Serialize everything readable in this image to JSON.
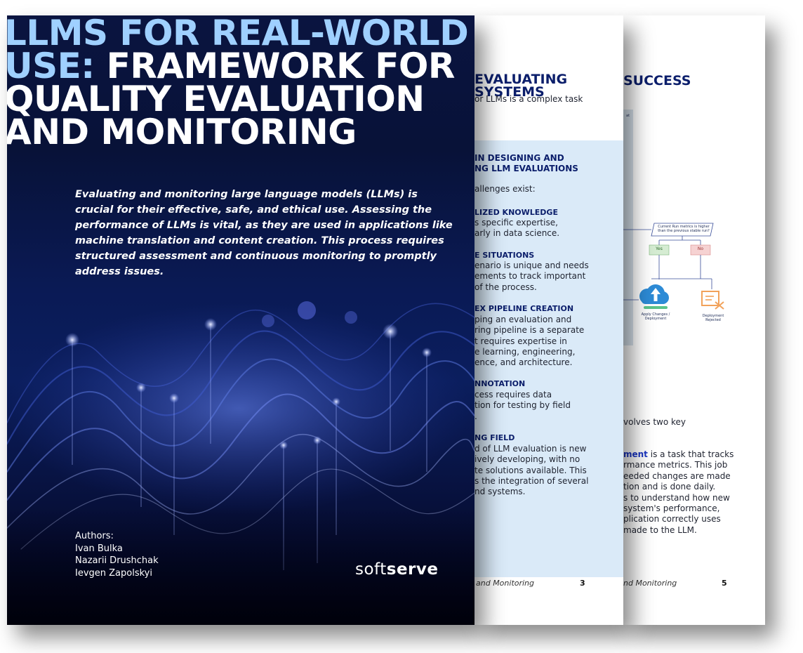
{
  "cover": {
    "title_accent": "LLMS FOR REAL-WORLD USE:",
    "title_line1_accent": "LLMS FOR REAL-WORLD",
    "title_line2_accent": "USE:",
    "title_line2_white": " FRAMEWORK FOR",
    "title_line3": "QUALITY EVALUATION",
    "title_line4": "AND MONITORING",
    "intro": "Evaluating and monitoring large language models (LLMs) is crucial for their effective, safe, and ethical use. Assessing the performance of LLMs is vital, as they are used in applications like machine translation and content creation. This process requires structured assessment and continuous monitoring to promptly address issues.",
    "authors_label": "Authors:",
    "authors": [
      "Ivan Bulka",
      "Nazarii Drushchak",
      "Ievgen Zapolskyi"
    ],
    "brand_light": "soft",
    "brand_bold": "serve"
  },
  "page_mid": {
    "heading_line1": "EVALUATING",
    "heading_line2": "SYSTEMS",
    "lead": "or LLMs is a complex task",
    "panel_title_line1": "IN DESIGNING AND",
    "panel_title_line2": "NG LLM EVALUATIONS",
    "panel_intro": "allenges exist:",
    "items": [
      {
        "label": "LIZED KNOWLEDGE",
        "lines": [
          "s specific expertise,",
          "arly in data science."
        ]
      },
      {
        "label": "E SITUATIONS",
        "lines": [
          "enario is unique and needs",
          "ements to track important",
          "of the process."
        ]
      },
      {
        "label": "EX PIPELINE CREATION",
        "lines": [
          "ping an evaluation and",
          "ring pipeline is a separate",
          "t requires expertise in",
          "e learning, engineering,",
          "ence, and architecture."
        ]
      },
      {
        "label": "NNOTATION",
        "lines": [
          "cess requires data",
          "tion for testing by field",
          "."
        ]
      },
      {
        "label": "NG FIELD",
        "lines": [
          "d of LLM evaluation is new",
          "ively developing, with no",
          "te solutions available. This",
          "s the integration of several",
          "nd systems."
        ]
      }
    ],
    "footer": "and Monitoring",
    "page_number": "3"
  },
  "page_back": {
    "heading": "SUCCESS",
    "flow": {
      "header_mark": "at",
      "decision": "Current Run metrics is higher than the previous stable run?",
      "yes": "Yes",
      "no": "No",
      "apply": "Apply Changes / Deployment",
      "rejected": "Deployment Rejected",
      "colors": {
        "yes_fill": "#d5ecd2",
        "no_fill": "#f6d2d2",
        "cloud": "#2d8bd6",
        "reject_icon": "#f2a25a"
      }
    },
    "text_line": "volves two key",
    "para_bold": "ment",
    "para_lines": [
      " is a task that tracks",
      "rmance metrics. This job",
      "eeded changes are made",
      "tion and is done daily.",
      "s to understand how new",
      " system's performance,",
      "plication correctly uses",
      "made to the LLM."
    ],
    "footer": "nd Monitoring",
    "page_number": "5"
  }
}
